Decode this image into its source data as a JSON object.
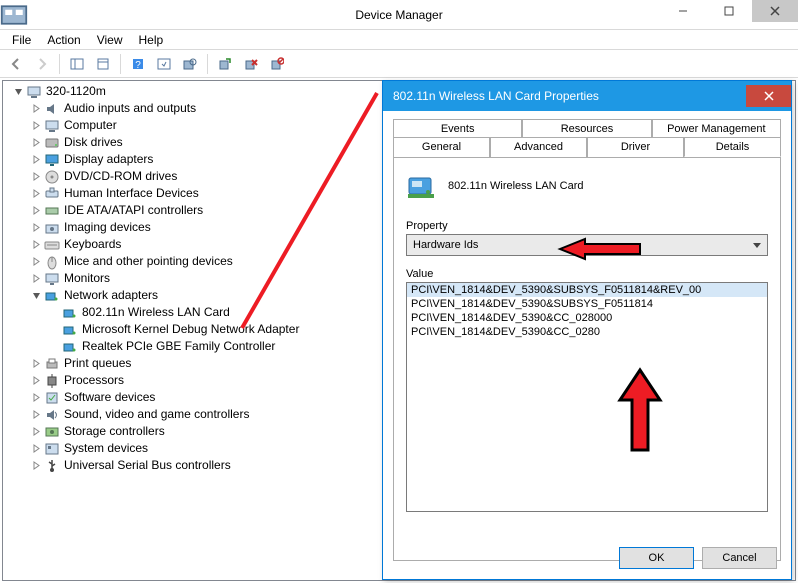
{
  "window": {
    "title": "Device Manager"
  },
  "menu": {
    "file": "File",
    "action": "Action",
    "view": "View",
    "help": "Help"
  },
  "tree": {
    "root": "320-1120m",
    "cats": [
      "Audio inputs and outputs",
      "Computer",
      "Disk drives",
      "Display adapters",
      "DVD/CD-ROM drives",
      "Human Interface Devices",
      "IDE ATA/ATAPI controllers",
      "Imaging devices",
      "Keyboards",
      "Mice and other pointing devices",
      "Monitors",
      "Network adapters",
      "Print queues",
      "Processors",
      "Software devices",
      "Sound, video and game controllers",
      "Storage controllers",
      "System devices",
      "Universal Serial Bus controllers"
    ],
    "net_children": [
      "802.11n Wireless LAN Card",
      "Microsoft Kernel Debug Network Adapter",
      "Realtek PCIe GBE Family Controller"
    ]
  },
  "dialog": {
    "title": "802.11n Wireless LAN Card Properties",
    "device_name": "802.11n Wireless LAN Card",
    "tabs_back": [
      "Events",
      "Resources",
      "Power Management"
    ],
    "tabs_front": [
      "General",
      "Advanced",
      "Driver",
      "Details"
    ],
    "active_tab": "Details",
    "property_label": "Property",
    "property_value": "Hardware Ids",
    "value_label": "Value",
    "values": [
      "PCI\\VEN_1814&DEV_5390&SUBSYS_F0511814&REV_00",
      "PCI\\VEN_1814&DEV_5390&SUBSYS_F0511814",
      "PCI\\VEN_1814&DEV_5390&CC_028000",
      "PCI\\VEN_1814&DEV_5390&CC_0280"
    ],
    "ok": "OK",
    "cancel": "Cancel"
  }
}
